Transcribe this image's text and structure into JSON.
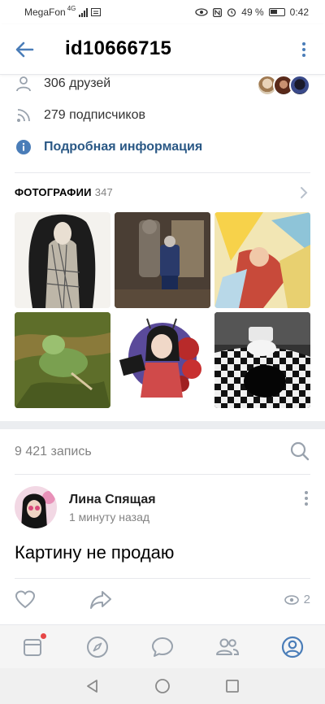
{
  "status_bar": {
    "carrier": "MegaFon",
    "network": "4G",
    "battery": "49 %",
    "time": "0:42"
  },
  "header": {
    "title": "id10666715",
    "back_icon": "arrow-left-icon",
    "more_icon": "more-vertical-icon"
  },
  "profile": {
    "friends": "306 друзей",
    "followers": "279 подписчиков",
    "details_link": "Подробная информация"
  },
  "photos": {
    "title": "ФОТОГРАФИИ",
    "count": "347"
  },
  "wall": {
    "posts_count": "9 421 запись"
  },
  "post": {
    "author": "Лина Спящая",
    "time": "1 минуту назад",
    "text": "Картину не продаю",
    "views": "2"
  },
  "colors": {
    "accent": "#4a7db8",
    "link": "#2a5885",
    "secondary_text": "#828282",
    "icon_gray": "#99a2ad",
    "badge": "#e64646"
  },
  "tabbar": {
    "items": [
      "news-icon",
      "discover-icon",
      "messages-icon",
      "friends-icon",
      "profile-icon"
    ],
    "active": "profile-icon"
  }
}
